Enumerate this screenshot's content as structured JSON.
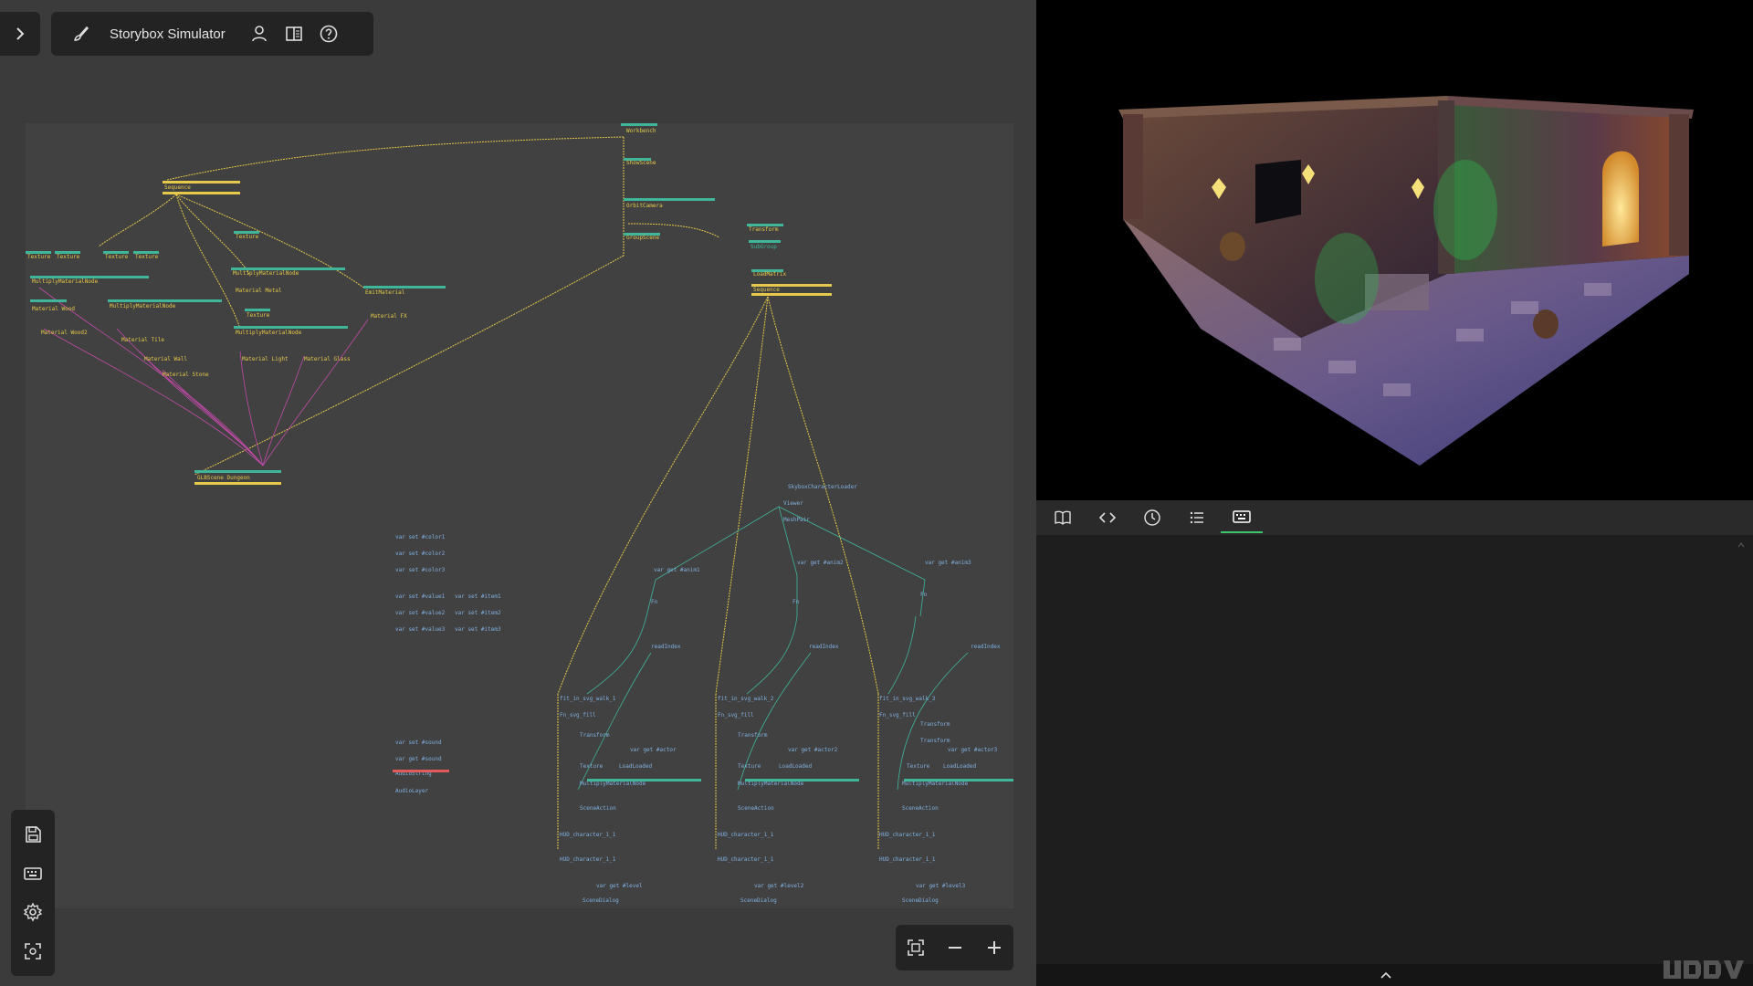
{
  "app": {
    "title": "Storybox Simulator"
  },
  "icons": {
    "expand": "chevron-right-icon",
    "brush": "brush-icon",
    "user": "user-icon",
    "library": "library-icon",
    "help": "help-icon",
    "save": "save-icon",
    "keyboard": "keyboard-icon",
    "settings": "settings-icon",
    "fit": "fit-screen-icon",
    "zoom_out": "minus-icon",
    "zoom_in": "plus-icon"
  },
  "right_tabs": [
    {
      "icon": "book-icon"
    },
    {
      "icon": "code-icon"
    },
    {
      "icon": "history-icon"
    },
    {
      "icon": "list-icon"
    },
    {
      "icon": "keyboard-icon",
      "active": true
    }
  ],
  "colors": {
    "accent": "#3ec26e",
    "wire_yellow": "#e6c84a",
    "wire_pink": "#c04aa8",
    "wire_teal": "#3fb59a",
    "panel_bg": "#1e1e1e",
    "toolbar_bg": "#232323"
  }
}
